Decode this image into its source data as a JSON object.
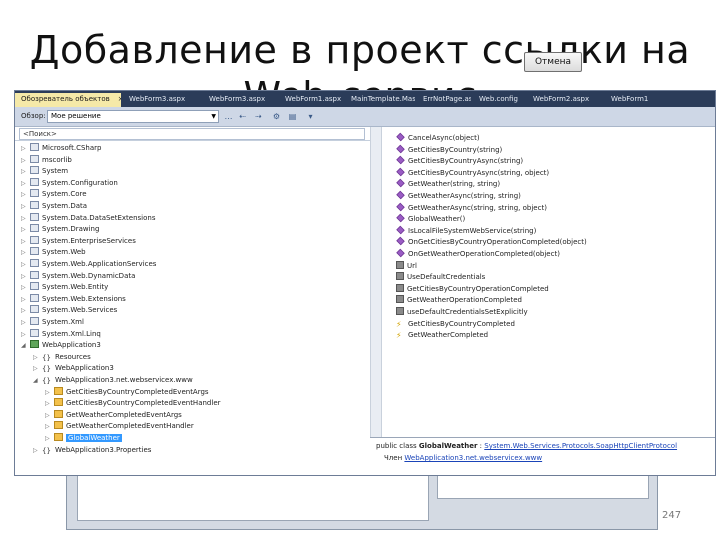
{
  "slide": {
    "title": "Добавление в проект ссылки на",
    "title_line2": "Web-сервис",
    "page_number": "247"
  },
  "tabs": [
    {
      "label": "Обозреватель объектов",
      "active": true
    },
    {
      "label": "WebForm3.aspx"
    },
    {
      "label": "WebForm3.aspx"
    },
    {
      "label": "WebForm1.aspx"
    },
    {
      "label": "MainTemplate.Master"
    },
    {
      "label": "ErrNotPage.aspx"
    },
    {
      "label": "Web.config"
    },
    {
      "label": "WebForm2.aspx"
    },
    {
      "label": "WebForm1"
    }
  ],
  "toolbar": {
    "browse_label": "Обзор:",
    "browse_value": "Мое решение"
  },
  "search": {
    "placeholder": "<Поиск>"
  },
  "tree": [
    {
      "label": "Microsoft.CSharp",
      "depth": 0,
      "icon": "ns",
      "exp": "▷"
    },
    {
      "label": "mscorlib",
      "depth": 0,
      "icon": "ns",
      "exp": "▷"
    },
    {
      "label": "System",
      "depth": 0,
      "icon": "ns",
      "exp": "▷"
    },
    {
      "label": "System.Configuration",
      "depth": 0,
      "icon": "ns",
      "exp": "▷"
    },
    {
      "label": "System.Core",
      "depth": 0,
      "icon": "ns",
      "exp": "▷"
    },
    {
      "label": "System.Data",
      "depth": 0,
      "icon": "ns",
      "exp": "▷"
    },
    {
      "label": "System.Data.DataSetExtensions",
      "depth": 0,
      "icon": "ns",
      "exp": "▷"
    },
    {
      "label": "System.Drawing",
      "depth": 0,
      "icon": "ns",
      "exp": "▷"
    },
    {
      "label": "System.EnterpriseServices",
      "depth": 0,
      "icon": "ns",
      "exp": "▷"
    },
    {
      "label": "System.Web",
      "depth": 0,
      "icon": "ns",
      "exp": "▷"
    },
    {
      "label": "System.Web.ApplicationServices",
      "depth": 0,
      "icon": "ns",
      "exp": "▷"
    },
    {
      "label": "System.Web.DynamicData",
      "depth": 0,
      "icon": "ns",
      "exp": "▷"
    },
    {
      "label": "System.Web.Entity",
      "depth": 0,
      "icon": "ns",
      "exp": "▷"
    },
    {
      "label": "System.Web.Extensions",
      "depth": 0,
      "icon": "ns",
      "exp": "▷"
    },
    {
      "label": "System.Web.Services",
      "depth": 0,
      "icon": "ns",
      "exp": "▷"
    },
    {
      "label": "System.Xml",
      "depth": 0,
      "icon": "ns",
      "exp": "▷"
    },
    {
      "label": "System.Xml.Linq",
      "depth": 0,
      "icon": "ns",
      "exp": "▷"
    },
    {
      "label": "WebApplication3",
      "depth": 0,
      "icon": "proj",
      "exp": "◢"
    },
    {
      "label": "Resources",
      "depth": 1,
      "icon": "br",
      "exp": "▷"
    },
    {
      "label": "WebApplication3",
      "depth": 1,
      "icon": "br",
      "exp": "▷"
    },
    {
      "label": "WebApplication3.net.webservicex.www",
      "depth": 1,
      "icon": "br",
      "exp": "◢"
    },
    {
      "label": "GetCitiesByCountryCompletedEventArgs",
      "depth": 2,
      "icon": "cls",
      "exp": "▷"
    },
    {
      "label": "GetCitiesByCountryCompletedEventHandler",
      "depth": 2,
      "icon": "cls",
      "exp": "▷"
    },
    {
      "label": "GetWeatherCompletedEventArgs",
      "depth": 2,
      "icon": "cls",
      "exp": "▷"
    },
    {
      "label": "GetWeatherCompletedEventHandler",
      "depth": 2,
      "icon": "cls",
      "exp": "▷"
    },
    {
      "label": "GlobalWeather",
      "depth": 2,
      "icon": "cls",
      "exp": "▷",
      "selected": true
    },
    {
      "label": "WebApplication3.Properties",
      "depth": 1,
      "icon": "br",
      "exp": "▷"
    }
  ],
  "members": [
    {
      "label": "CancelAsync(object)",
      "icon": "method"
    },
    {
      "label": "GetCitiesByCountry(string)",
      "icon": "method"
    },
    {
      "label": "GetCitiesByCountryAsync(string)",
      "icon": "method"
    },
    {
      "label": "GetCitiesByCountryAsync(string, object)",
      "icon": "method"
    },
    {
      "label": "GetWeather(string, string)",
      "icon": "method"
    },
    {
      "label": "GetWeatherAsync(string, string)",
      "icon": "method"
    },
    {
      "label": "GetWeatherAsync(string, string, object)",
      "icon": "method"
    },
    {
      "label": "GlobalWeather()",
      "icon": "method"
    },
    {
      "label": "IsLocalFileSystemWebService(string)",
      "icon": "method"
    },
    {
      "label": "OnGetCitiesByCountryOperationCompleted(object)",
      "icon": "method"
    },
    {
      "label": "OnGetWeatherOperationCompleted(object)",
      "icon": "method"
    },
    {
      "label": "Url",
      "icon": "prop"
    },
    {
      "label": "UseDefaultCredentials",
      "icon": "prop"
    },
    {
      "label": "GetCitiesByCountryOperationCompleted",
      "icon": "prop"
    },
    {
      "label": "GetWeatherOperationCompleted",
      "icon": "prop"
    },
    {
      "label": "useDefaultCredentialsSetExplicitly",
      "icon": "prop"
    },
    {
      "label": "GetCitiesByCountryCompleted",
      "icon": "event"
    },
    {
      "label": "GetWeatherCompleted",
      "icon": "event"
    }
  ],
  "detail": {
    "line1_prefix": "public class ",
    "line1_class": "GlobalWeather",
    "line1_sep": " : ",
    "line1_base": "System.Web.Services.Protocols.SoapHttpClientProtocol",
    "line2_prefix": "Член ",
    "line2_ns": "WebApplication3.net.webservicex.www"
  },
  "dialog": {
    "cancel_label": "Отмена"
  }
}
